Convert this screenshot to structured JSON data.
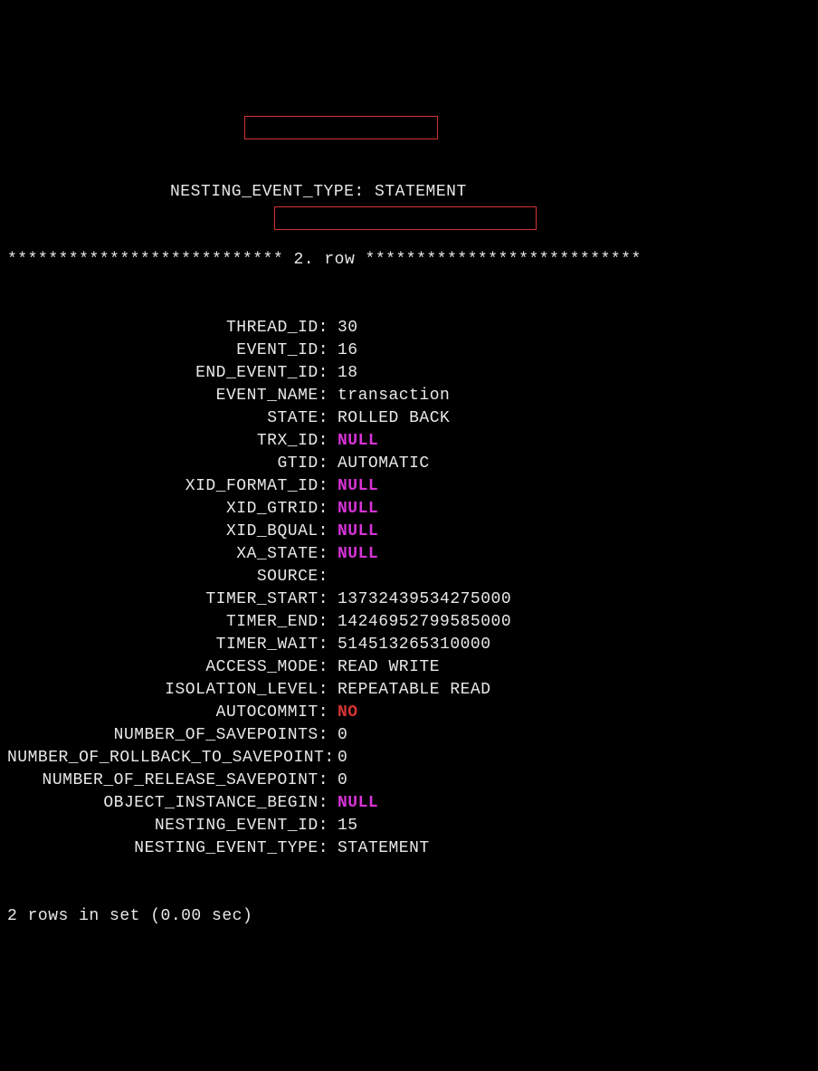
{
  "partial_header": "NESTING_EVENT_TYPE: STATEMENT",
  "row_separator": "*************************** 2. row ***************************",
  "fields": [
    {
      "label": "THREAD_ID",
      "value": "30",
      "class": ""
    },
    {
      "label": "EVENT_ID",
      "value": "16",
      "class": ""
    },
    {
      "label": "END_EVENT_ID",
      "value": "18",
      "class": ""
    },
    {
      "label": "EVENT_NAME",
      "value": "transaction",
      "class": ""
    },
    {
      "label": "STATE",
      "value": "ROLLED BACK",
      "class": ""
    },
    {
      "label": "TRX_ID",
      "value": "NULL",
      "class": "null-val"
    },
    {
      "label": "GTID",
      "value": "AUTOMATIC",
      "class": ""
    },
    {
      "label": "XID_FORMAT_ID",
      "value": "NULL",
      "class": "null-val"
    },
    {
      "label": "XID_GTRID",
      "value": "NULL",
      "class": "null-val"
    },
    {
      "label": "XID_BQUAL",
      "value": "NULL",
      "class": "null-val"
    },
    {
      "label": "XA_STATE",
      "value": "NULL",
      "class": "null-val"
    },
    {
      "label": "SOURCE",
      "value": "",
      "class": ""
    },
    {
      "label": "TIMER_START",
      "value": "13732439534275000",
      "class": ""
    },
    {
      "label": "TIMER_END",
      "value": "14246952799585000",
      "class": ""
    },
    {
      "label": "TIMER_WAIT",
      "value": "514513265310000",
      "class": ""
    },
    {
      "label": "ACCESS_MODE",
      "value": "READ WRITE",
      "class": ""
    },
    {
      "label": "ISOLATION_LEVEL",
      "value": "REPEATABLE READ",
      "class": ""
    },
    {
      "label": "AUTOCOMMIT",
      "value": "NO",
      "class": "no-val"
    },
    {
      "label": "NUMBER_OF_SAVEPOINTS",
      "value": "0",
      "class": ""
    },
    {
      "label": "NUMBER_OF_ROLLBACK_TO_SAVEPOINT",
      "value": "0",
      "class": ""
    },
    {
      "label": "NUMBER_OF_RELEASE_SAVEPOINT",
      "value": "0",
      "class": ""
    },
    {
      "label": "OBJECT_INSTANCE_BEGIN",
      "value": "NULL",
      "class": "null-val"
    },
    {
      "label": "NESTING_EVENT_ID",
      "value": "15",
      "class": ""
    },
    {
      "label": "NESTING_EVENT_TYPE",
      "value": "STATEMENT",
      "class": ""
    }
  ],
  "summary": "2 rows in set (0.00 sec)"
}
